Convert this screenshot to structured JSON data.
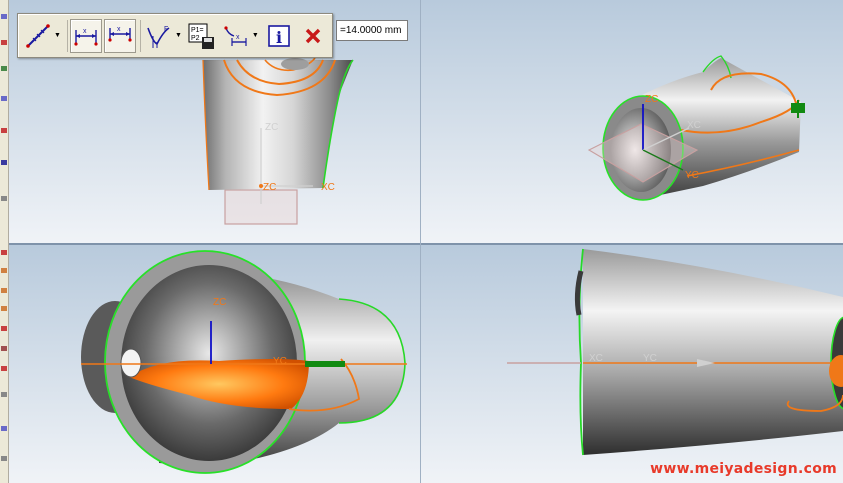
{
  "toolbar": {
    "buttons": [
      {
        "name": "measure-distance",
        "icon": "ruler-diagonal-icon",
        "has_dropdown": true
      },
      {
        "name": "horizontal-dimension",
        "icon": "dimension-x-icon",
        "pressed": true
      },
      {
        "name": "horizontal-dimension-alt",
        "icon": "dimension-x-alt-icon",
        "pressed": true
      },
      {
        "name": "angle-measure",
        "icon": "angle-measure-icon",
        "has_dropdown": true
      },
      {
        "name": "point-to-point-save",
        "icon": "p1-p2-save-icon",
        "label_top": "P1=",
        "label_bottom": "P2"
      },
      {
        "name": "dimension-variant",
        "icon": "dimension-variant-icon",
        "has_dropdown": true
      },
      {
        "name": "info",
        "icon": "info-icon",
        "label": "i"
      },
      {
        "name": "close",
        "icon": "close-icon",
        "label": "✕"
      }
    ]
  },
  "measurement": {
    "value": "=14.0000 mm"
  },
  "axes": {
    "zc": "ZC",
    "xc": "XC",
    "yc": "YC"
  },
  "watermark": "www.meiyadesign.com",
  "colors": {
    "background_top": "#c2d2e2",
    "background_bottom": "#eef2f6",
    "edge_green": "#28e028",
    "curve_orange": "#f07818",
    "axis_blue": "#1010c8",
    "plane_pink": "#c8a0a0",
    "watermark_red": "#e83a2a"
  }
}
